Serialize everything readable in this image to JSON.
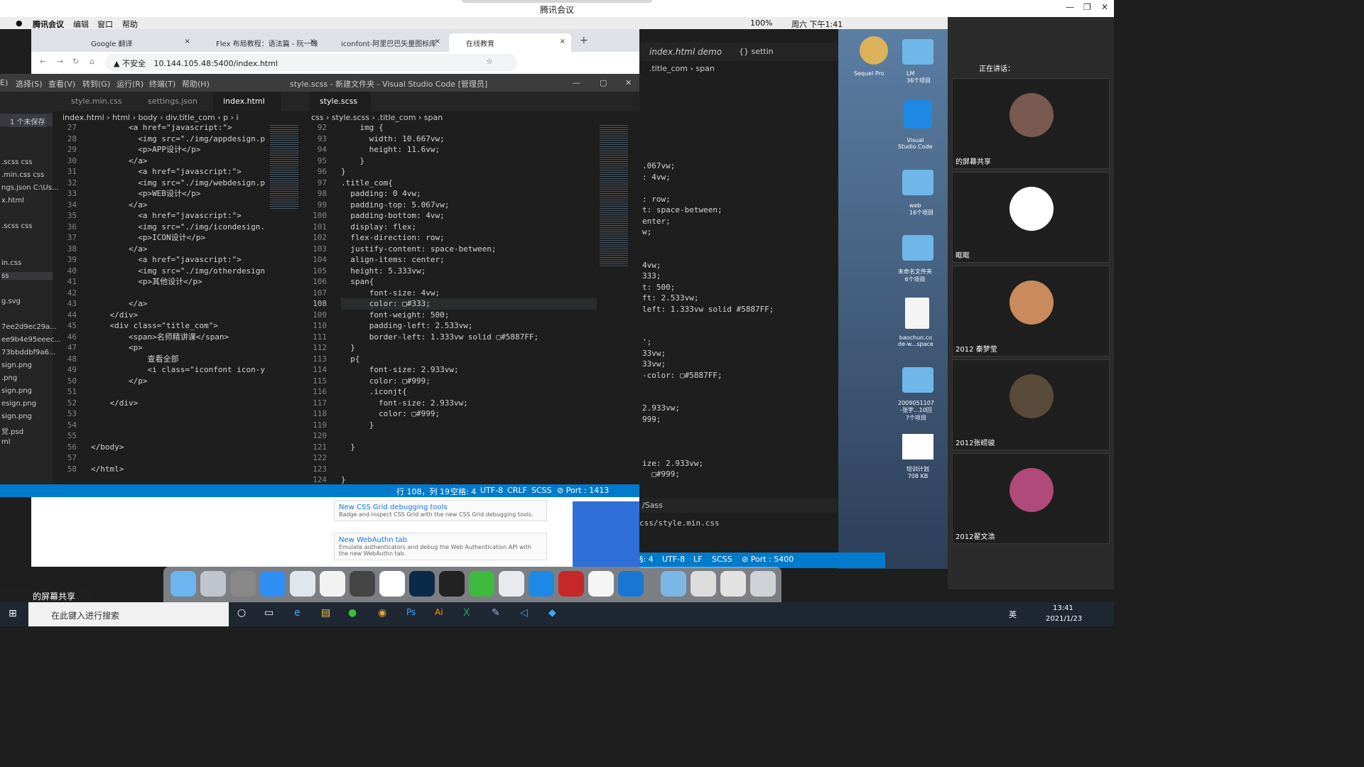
{
  "window": {
    "title": "腾讯会议",
    "min": "—",
    "max": "❐",
    "close": "✕"
  },
  "mac_menu": {
    "app": "腾讯会议",
    "items": [
      "编辑",
      "窗口",
      "帮助"
    ],
    "battery": "100%",
    "clock": "周六 下午1:41"
  },
  "chrome": {
    "tabs": [
      {
        "label": "Google 翻译",
        "close": "×"
      },
      {
        "label": "Flex 布局教程：语法篇 - 阮一峰",
        "close": "×"
      },
      {
        "label": "iconfont-阿里巴巴矢量图标库",
        "close": "×"
      },
      {
        "label": "在线教育",
        "close": "×"
      }
    ],
    "new_tab": "+",
    "insecure": "不安全",
    "url": "10.144.105.48:5400/index.html"
  },
  "vscode": {
    "menu": [
      "E)",
      "选择(S)",
      "查看(V)",
      "转到(G)",
      "运行(R)",
      "终端(T)",
      "帮助(H)"
    ],
    "title": "style.scss - 新建文件夹 - Visual Studio Code [管理员]",
    "unsaved": "1 个未保存",
    "explorer": [
      ".scss  css",
      ".min.css  css",
      "ngs.json  C:\\Us...",
      "x.html",
      ".scss  css",
      "in.css",
      "ss",
      "g.svg",
      "7ee2d9ec29a...",
      "ee9b4e95eeec...",
      "73bbddbf9a6...",
      "sign.png",
      ".png",
      "sign.png",
      "esign.png",
      "sign.png",
      "觉.psd",
      "ml"
    ],
    "left_tabs": [
      "style.min.css",
      "settings.json",
      "index.html"
    ],
    "right_tabs": [
      "style.scss"
    ],
    "left_crumb": "index.html  ›  html  ›  body  ›  div.title_com  ›  p  ›  i",
    "right_crumb": "css  ›  style.scss  ›  .title_com  ›  span",
    "left_lines": [
      "27",
      "28",
      "29",
      "30",
      "31",
      "32",
      "33",
      "34",
      "35",
      "36",
      "37",
      "38",
      "39",
      "40",
      "41",
      "42",
      "43",
      "44",
      "45",
      "46",
      "47",
      "48",
      "49",
      "50",
      "51",
      "52",
      "53",
      "54",
      "55",
      "56",
      "57",
      "58"
    ],
    "left_code": [
      "        <a href=\"javascript:\">",
      "          <img src=\"./img/appdesign.pn",
      "          <p>APP设计</p>",
      "        </a>",
      "          <a href=\"javascript:\">",
      "          <img src=\"./img/webdesign.p",
      "          <p>WEB设计</p>",
      "        </a>",
      "          <a href=\"javascript:\">",
      "          <img src=\"./img/icondesign.",
      "          <p>ICON设计</p>",
      "        </a>",
      "          <a href=\"javascript:\">",
      "          <img src=\"./img/otherdesign",
      "          <p>其他设计</p>",
      "",
      "        </a>",
      "    </div>",
      "    <div class=\"title_com\">",
      "        <span>名师精讲课</span>",
      "        <p>",
      "            查看全部",
      "            <i class=\"iconfont icon-y",
      "        </p>",
      "",
      "    </div>",
      "",
      "",
      "",
      "</body>",
      "",
      "</html>"
    ],
    "right_lines": [
      "92",
      "93",
      "94",
      "95",
      "96",
      "97",
      "98",
      "99",
      "100",
      "101",
      "102",
      "103",
      "104",
      "105",
      "106",
      "107",
      "108",
      "109",
      "110",
      "111",
      "112",
      "113",
      "114",
      "115",
      "116",
      "117",
      "118",
      "119",
      "120",
      "121",
      "122",
      "123",
      "124"
    ],
    "right_code": [
      "    img {",
      "      width: 10.667vw;",
      "      height: 11.6vw;",
      "    }",
      "}",
      ".title_com{",
      "  padding: 0 4vw;",
      "  padding-top: 5.067vw;",
      "  padding-bottom: 4vw;",
      "  display: flex;",
      "  flex-direction: row;",
      "  justify-content: space-between;",
      "  align-items: center;",
      "  height: 5.333vw;",
      "  span{",
      "      font-size: 4vw;",
      "      color: ▢#333;",
      "      font-weight: 500;",
      "      padding-left: 2.533vw;",
      "      border-left: 1.333vw solid ▢#5887FF;",
      "  }",
      "  p{",
      "      font-size: 2.933vw;",
      "      color: ▢#999;",
      "      .iconjt{",
      "        font-size: 2.933vw;",
      "        color: ▢#999;",
      "      }",
      "",
      "  }",
      "",
      "",
      "}"
    ],
    "status": {
      "pos": "行 108，列 19",
      "spaces": "空格: 4",
      "enc": "UTF-8",
      "eol": "CRLF",
      "lang": "SCSS",
      "port": "⊘ Port : 1413"
    }
  },
  "vscode2": {
    "tab": "index.html  demo",
    "tab2": "{} settin",
    "crumb": ".title_com  ›  span",
    "code": [
      ".067vw;",
      ": 4vw;",
      "",
      ": row;",
      "t: space-between;",
      "enter;",
      "w;",
      "",
      "",
      "4vw;",
      "333;",
      "t: 500;",
      "ft: 2.533vw;",
      "left: 1.333vw solid #5887FF;",
      "",
      "",
      "';",
      "33vw;",
      "33vw;",
      "-color: ▢#5887FF;",
      "",
      "",
      "2.933vw;",
      "999;",
      "",
      "",
      "",
      "ize: 2.933vw;",
      "  ▢#999;"
    ],
    "terminal_select": "/Sass",
    "terminal_line": "css/style.min.css",
    "status": {
      "spaces": "§: 4",
      "enc": "UTF-8",
      "eol": "LF",
      "lang": "SCSS",
      "port": "⊘ Port : 5400"
    }
  },
  "tencent": {
    "speaking": "正在讲话：",
    "participants": [
      "的屏幕共享",
      "眶眶",
      "2012 秦梦莹",
      "2012张崂骏",
      "2012翟文浩"
    ],
    "screen_share": "的屏幕共享"
  },
  "desktop": [
    {
      "label": "Sequel Pro"
    },
    {
      "label": "LM\n36个项目"
    },
    {
      "label": "Visual\nStudio Code"
    },
    {
      "label": "web\n16个项目"
    },
    {
      "label": "未命名文件夹\n6个项目"
    },
    {
      "label": "baochun.co\nde-w...space"
    },
    {
      "label": "2009051107\n-张宇...10回\n7个项目"
    },
    {
      "label": "培训计划\n708 KB"
    }
  ],
  "devtools_news": [
    {
      "title": "New CSS Grid debugging tools",
      "desc": "Badge and inspect CSS Grid with the new CSS Grid debugging tools."
    },
    {
      "title": "New WebAuthn tab",
      "desc": "Emulate authenticators and debug the Web Authentication API with the new WebAuthn tab."
    }
  ],
  "taskbar": {
    "search": "在此键入进行搜索",
    "time": "13:41",
    "date": "2021/1/23",
    "ime": "英"
  }
}
